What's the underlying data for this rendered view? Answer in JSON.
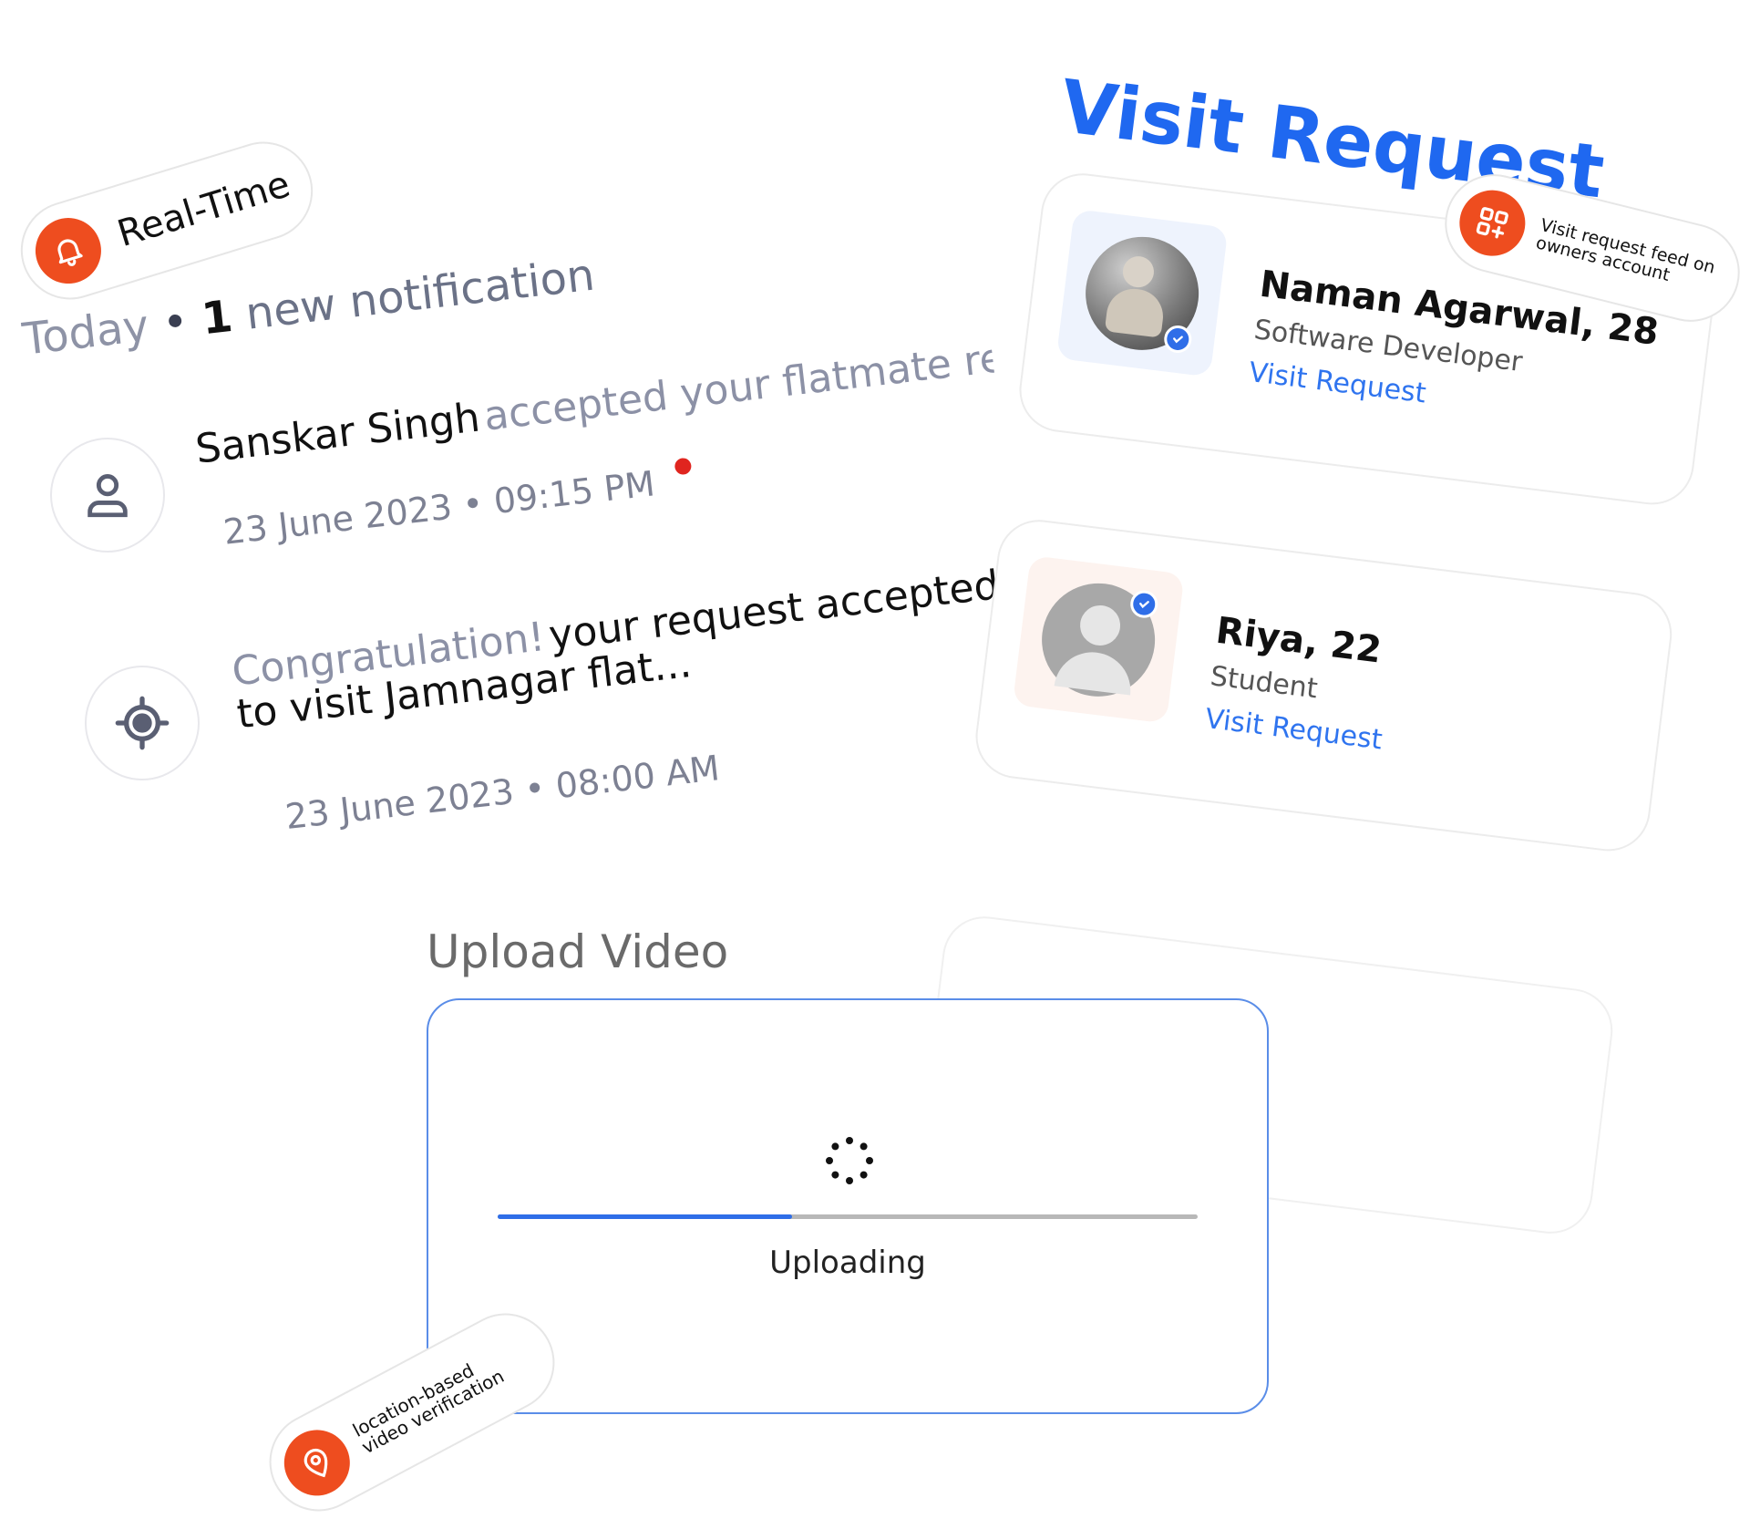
{
  "badges": {
    "realtime": {
      "label": "Real-Time",
      "icon": "bell-icon"
    },
    "visit_feed": {
      "line1": "Visit request feed on",
      "line2": "owners account",
      "icon": "grid-plus-icon"
    },
    "location": {
      "line1": "location-based",
      "line2": "video verification",
      "icon": "location-pin-icon"
    }
  },
  "notifications": {
    "header": {
      "today": "Today",
      "separator": "•",
      "count": "1",
      "suffix": "new notification"
    },
    "items": [
      {
        "icon": "user-icon",
        "name": "Sanskar Singh",
        "text": "accepted your flatmate request",
        "time": "23 June 2023 • 09:15 PM",
        "unread": true
      },
      {
        "icon": "target-icon",
        "muted": "Congratulation!",
        "text_line1": "your request accepted",
        "text_line2": "to visit Jamnagar flat...",
        "time": "23 June 2023 • 08:00 AM",
        "unread": false
      }
    ]
  },
  "visit_request": {
    "title": "Visit Request",
    "cards": [
      {
        "name": "Naman Agarwal, 28",
        "role": "Software Developer",
        "link": "Visit Request",
        "verified": true,
        "avatar": "photo"
      },
      {
        "name": "Riya, 22",
        "role": "Student",
        "link": "Visit Request",
        "verified": true,
        "avatar": "placeholder"
      }
    ]
  },
  "upload": {
    "title": "Upload Video",
    "status": "Uploading",
    "progress": 0.42,
    "colors": {
      "fill": "#2f6ee8",
      "track": "#b8b8b8"
    }
  },
  "colors": {
    "accent_orange": "#ee4d1f",
    "accent_blue": "#1f68f0",
    "unread_dot": "#e0251f"
  }
}
